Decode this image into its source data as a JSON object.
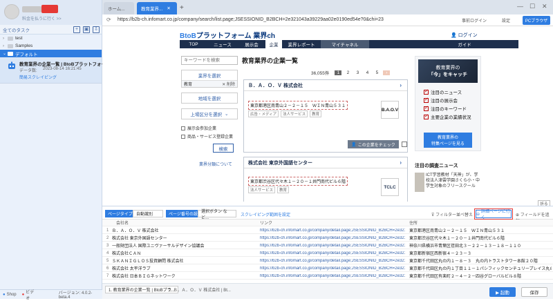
{
  "sidebar": {
    "subtitle": "料金を払うに行く >>",
    "tasks_header": "全てのタスク",
    "tree": [
      {
        "label": "test"
      },
      {
        "label": "Samples"
      },
      {
        "label": "デフォルト"
      }
    ],
    "task": {
      "title": "教育業界の企業一覧 | BtoBプラットフォー",
      "label": "データ数:",
      "date": "2023-08-14 16:21:45",
      "status": "簡易スクレイピング"
    },
    "bottom": {
      "shop": "Shop",
      "help": "ビデオ",
      "version": "バージョン: 4.0.2-beta.4"
    }
  },
  "browser": {
    "tabs": [
      {
        "label": "ホーム..."
      },
      {
        "label": "教育業界..."
      }
    ],
    "url": "https://b2b-ch.infomart.co.jp/company/search/list.page;JSESSIONID_B2BCH=2e321043a39229aa02e0190ed54e?0&chi=23",
    "mode_label": "事前ログイン",
    "mode_label2": "設定",
    "pc_label": "PCブラウザ"
  },
  "site": {
    "logo_prefix": "BtoB",
    "logo_text": "プラットフォーム 業界ch",
    "login": "ログイン",
    "nav": [
      "TOP",
      "ニュース",
      "展示会",
      "企業",
      "業界レポート",
      "マイチャネル"
    ],
    "nav_guide": "ガイド",
    "keyword_placeholder": "キーワードを検索",
    "industry_select": "業界を選択",
    "industry_tag": "教育",
    "industry_tag_x": "✕ 削除",
    "region_select": "地域を選択",
    "market_select": "上場区分を選択",
    "check1": "展示会参加企業",
    "check2": "商品・サービス登録企業",
    "search": "検索",
    "category_link": "業界分類について",
    "list_title": "教育業界の企業一覧",
    "count": "36,055件",
    "pages": [
      "1",
      "2",
      "3",
      "4",
      "5"
    ],
    "cards": [
      {
        "name": "Ｂ．Ａ．Ｏ．Ｖ 株式会社",
        "addr": "東京都港区南青山２－２－１５　ＷＩＮ青山５３１",
        "tags": [
          "広告・メディア",
          "法人サービス",
          "教育"
        ],
        "logo": "B.A.O.V"
      },
      {
        "name": "株式会社 東京外国語センター",
        "addr": "東京都渋谷区代々木１－２０－１井門南代ビル６階",
        "tags": [
          "法人サービス",
          "教育"
        ],
        "logo": "TCLC"
      }
    ],
    "check_btn": "この企業をチェック",
    "promo": {
      "title1": "教育業界の",
      "title2": "「今」をキャッチ",
      "items": [
        "注目のニュース",
        "注目の展示会",
        "注目のキーワード",
        "主要企業の業績状況"
      ],
      "btn1": "教育業界の",
      "btn2": "特集ページを見る"
    },
    "news_title": "注目の調査ニュース",
    "news_text": "ICT学習教材「天神」が、学校法人津雲学園さくら小・中学生対象のフリースクール"
  },
  "panel": {
    "page_type_label": "ページタイプ",
    "page_type_value": "自動識別",
    "pagination_label": "ページ番号の設定",
    "pagination_value": "選択ボタン など...",
    "scrape_range": "スクレイピング範囲を設定",
    "filter": "フィルター",
    "sort": "並べ替え",
    "detail_btn": "詳細ページに行く",
    "add_field": "フィールドを追加",
    "collapse": "折る",
    "columns": [
      "会社名",
      "リンク",
      "住所"
    ],
    "rows": [
      {
        "idx": "1",
        "name": "Ｂ．Ａ．Ｏ．Ｖ 株式会社",
        "link": "https://b2b-ch.infomart.co.jp/company/detail.page;JSESSIONID_B2BCH=2e321043a39229...",
        "addr": "東京都港区南青山２－２－１５　ＷＩＮ青山５３１"
      },
      {
        "idx": "2",
        "name": "株式会社 東京外国語センター",
        "link": "https://b2b-ch.infomart.co.jp/company/detail.page;JSESSIONID_B2BCH=2e321043a39229...",
        "addr": "東京都渋谷区代々木１－２０－１井門南代ビル６階"
      },
      {
        "idx": "3",
        "name": "一般財団法人 国際ユニヴァーサルデザイン協議会",
        "link": "https://b2b-ch.infomart.co.jp/company/detail.page;JSESSIONID_B2BCH=2e321043a39229...",
        "addr": "神奈川県横浜市青葉区荏田北３－２２－１３－１８－１１０"
      },
      {
        "idx": "4",
        "name": "株式会社ＣＡＮ",
        "link": "https://b2b-ch.infomart.co.jp/company/detail.page;JSESSIONID_B2BCH=2e321043a39229...",
        "addr": "東京都新宿区西新宿４－２３－３"
      },
      {
        "idx": "5",
        "name": "ＳＫＡＮＩＧＬＯＳ投資顧問 株式会社",
        "link": "https://b2b-ch.infomart.co.jp/company/detail.page;JSESSIONID_B2BCH=2e321043a39229...",
        "addr": "東京都千代田区丸の内１－８－３　丸の内トラストタワー本館２０階"
      },
      {
        "idx": "6",
        "name": "株式会社 太平洋ラブ",
        "link": "https://b2b-ch.infomart.co.jp/company/detail.page;JSESSIONID_B2BCH=2e321043a39229...",
        "addr": "東京都千代田区丸の内１丁目１１－１パシフィックセンチュリープレイス丸の内２８階"
      },
      {
        "idx": "7",
        "name": "株式会社 日本ＢＩＧネットワーク",
        "link": "https://b2b-ch.infomart.co.jp/company/detail.page;JSESSIONID_B2BCH=2e321043a39229...",
        "addr": "東京都千代田区有楽町２－４－２－四谷グローバルビル８階"
      }
    ]
  },
  "bottom": {
    "tab1": "1. 教育業界の企業一覧 | BtoBプラ...",
    "tab2": "2. Ｂ．Ａ．Ｏ．Ｖ 株式会社 | Bt...",
    "run": "▶ 起動",
    "save": "保存"
  }
}
